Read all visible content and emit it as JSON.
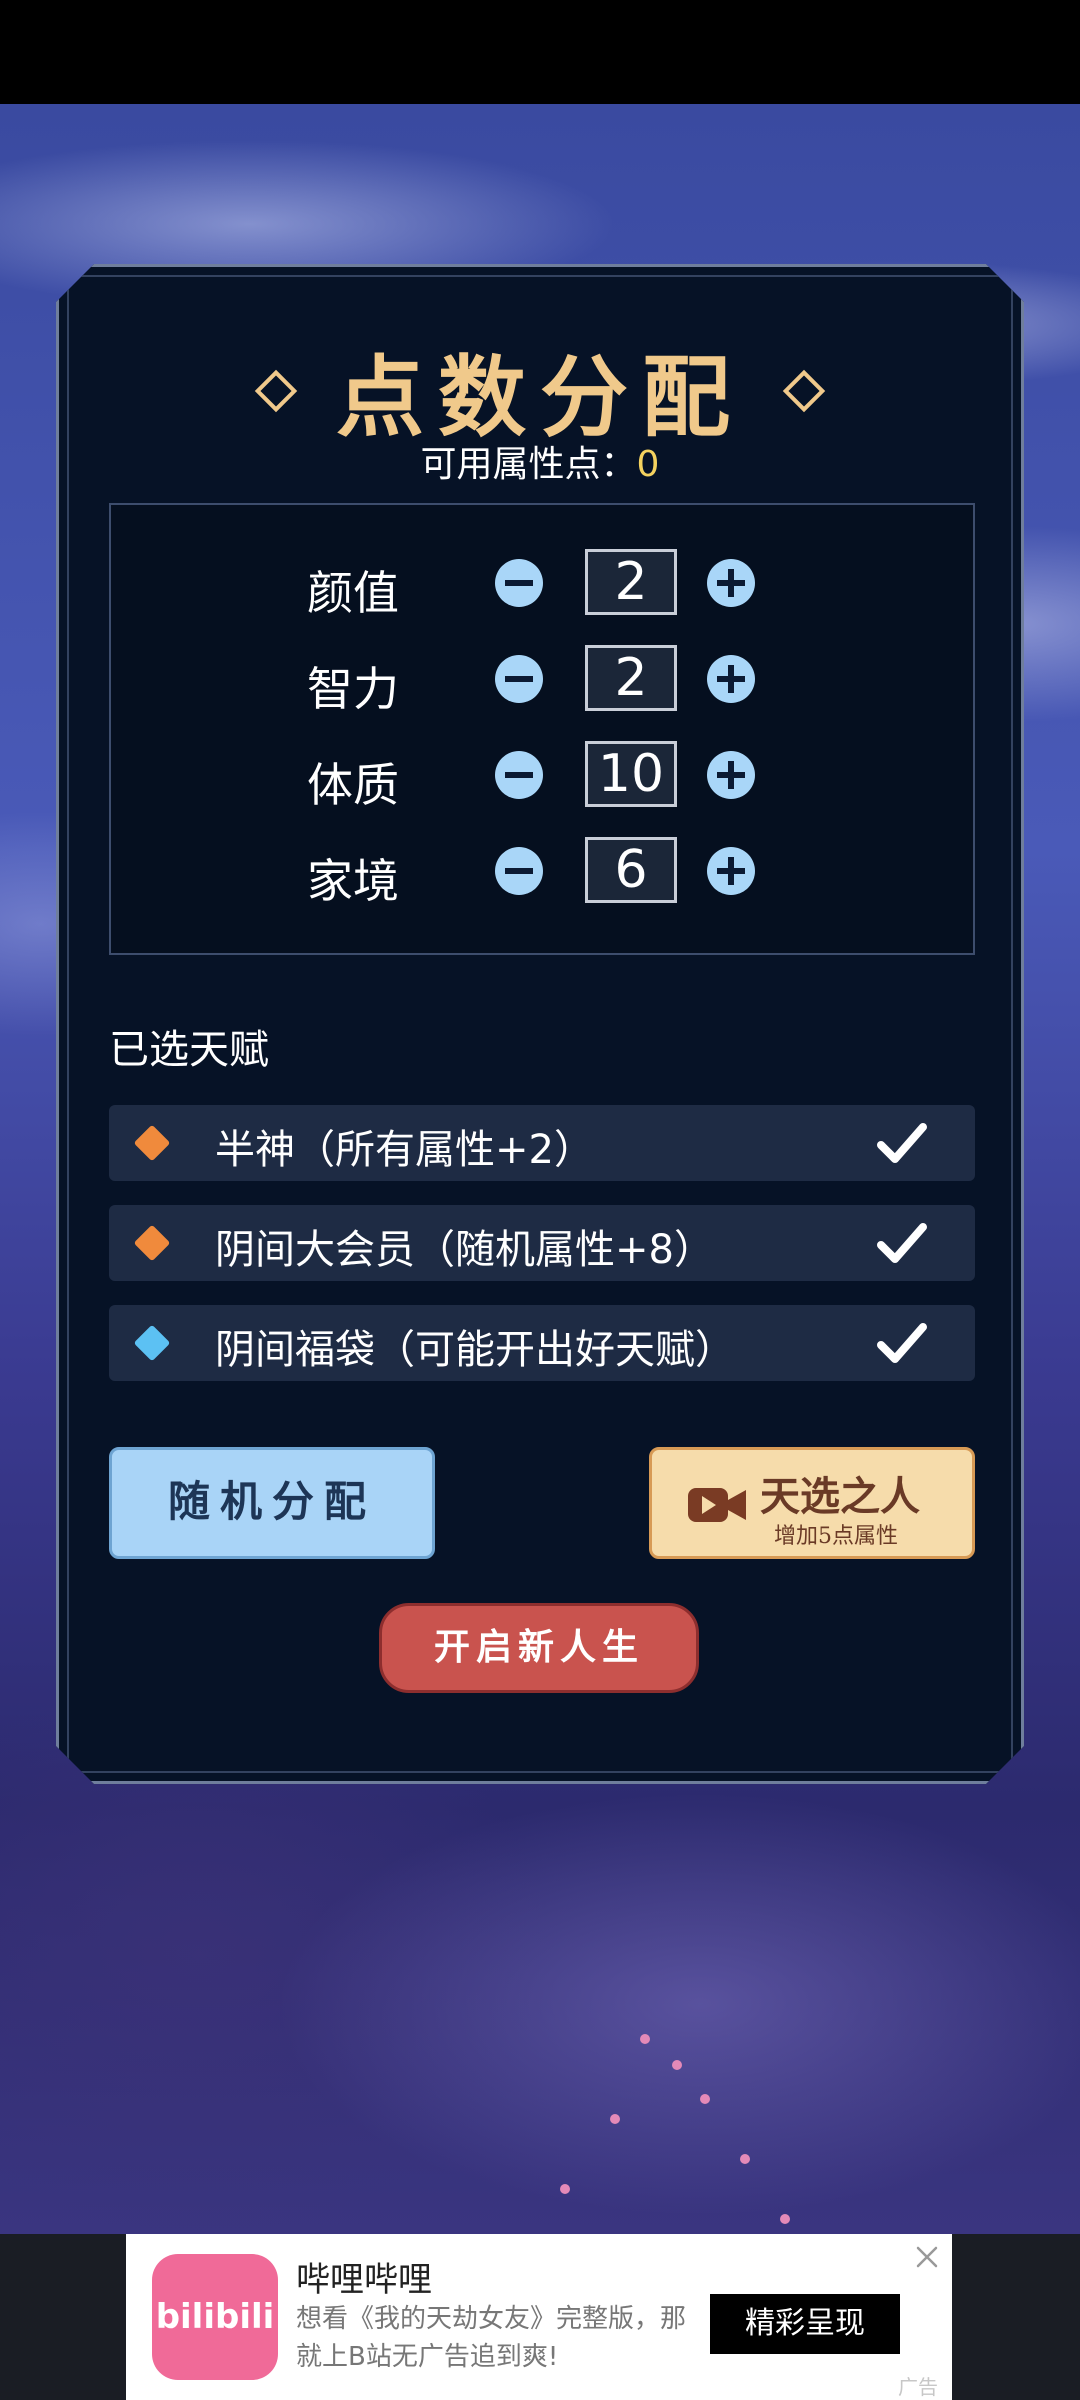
{
  "panel": {
    "title": "点数分配",
    "points_label": "可用属性点：",
    "points_value": "0"
  },
  "attributes": [
    {
      "label": "颜值",
      "value": "2"
    },
    {
      "label": "智力",
      "value": "2"
    },
    {
      "label": "体质",
      "value": "10"
    },
    {
      "label": "家境",
      "value": "6"
    }
  ],
  "talents_section": {
    "title": "已选天赋",
    "items": [
      {
        "text": "半神（所有属性+2）",
        "gem_color": "#f08a3c"
      },
      {
        "text": "阴间大会员（随机属性+8）",
        "gem_color": "#f08a3c"
      },
      {
        "text": "阴间福袋（可能开出好天赋）",
        "gem_color": "#5cc1f3"
      }
    ]
  },
  "buttons": {
    "random": "随机分配",
    "chosen_main": "天选之人",
    "chosen_sub": "增加5点属性",
    "start": "开启新人生"
  },
  "ad": {
    "logo_text": "bilibili",
    "title": "哔哩哔哩",
    "desc": "想看《我的天劫女友》完整版，那就上B站无广告追到爽!",
    "cta": "精彩呈现",
    "badge": "广告"
  }
}
